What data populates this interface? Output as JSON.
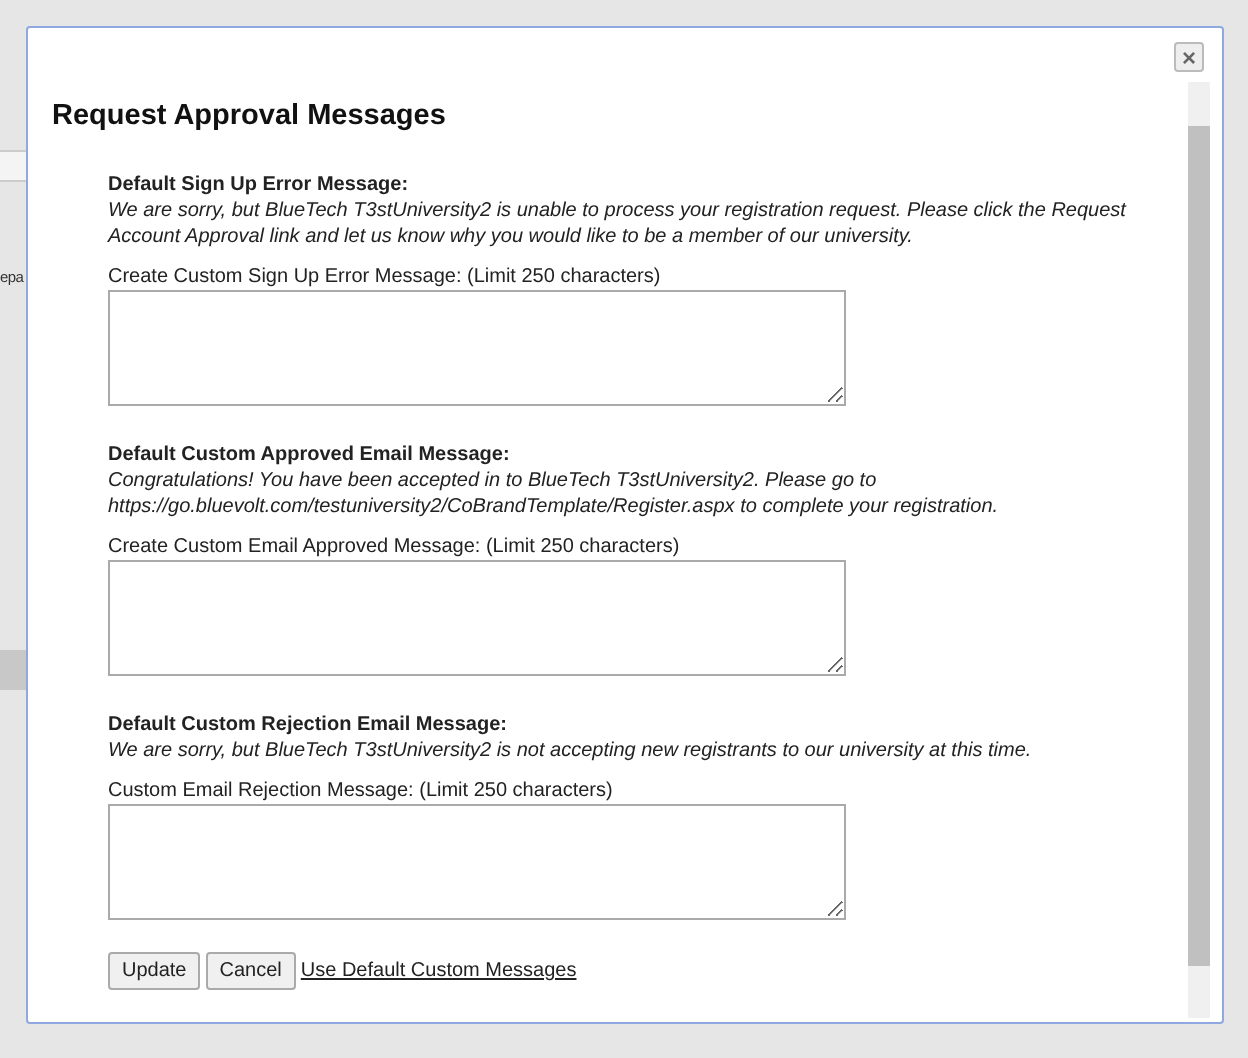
{
  "background": {
    "fragment": "epa"
  },
  "dialog": {
    "title": "Request Approval Messages",
    "close": "×",
    "sections": [
      {
        "heading": "Default Sign Up Error Message:",
        "default_text": "We are sorry, but BlueTech T3stUniversity2 is unable to process your registration request. Please click the Request Account Approval link and let us know why you would like to be a member of our university.",
        "field_label": "Create Custom Sign Up Error Message: (Limit 250 characters)"
      },
      {
        "heading": "Default Custom Approved Email Message:",
        "default_text": "Congratulations! You have been accepted in to BlueTech T3stUniversity2. Please go to https://go.bluevolt.com/testuniversity2/CoBrandTemplate/Register.aspx to complete your registration.",
        "field_label": "Create Custom Email Approved Message: (Limit 250 characters)"
      },
      {
        "heading": "Default Custom Rejection Email Message:",
        "default_text": "We are sorry, but BlueTech T3stUniversity2 is not accepting new registrants to our university at this time.",
        "field_label": "Custom Email Rejection Message: (Limit 250 characters)"
      }
    ],
    "buttons": [
      "Update",
      "Cancel"
    ],
    "link": "Use Default Custom Messages"
  }
}
